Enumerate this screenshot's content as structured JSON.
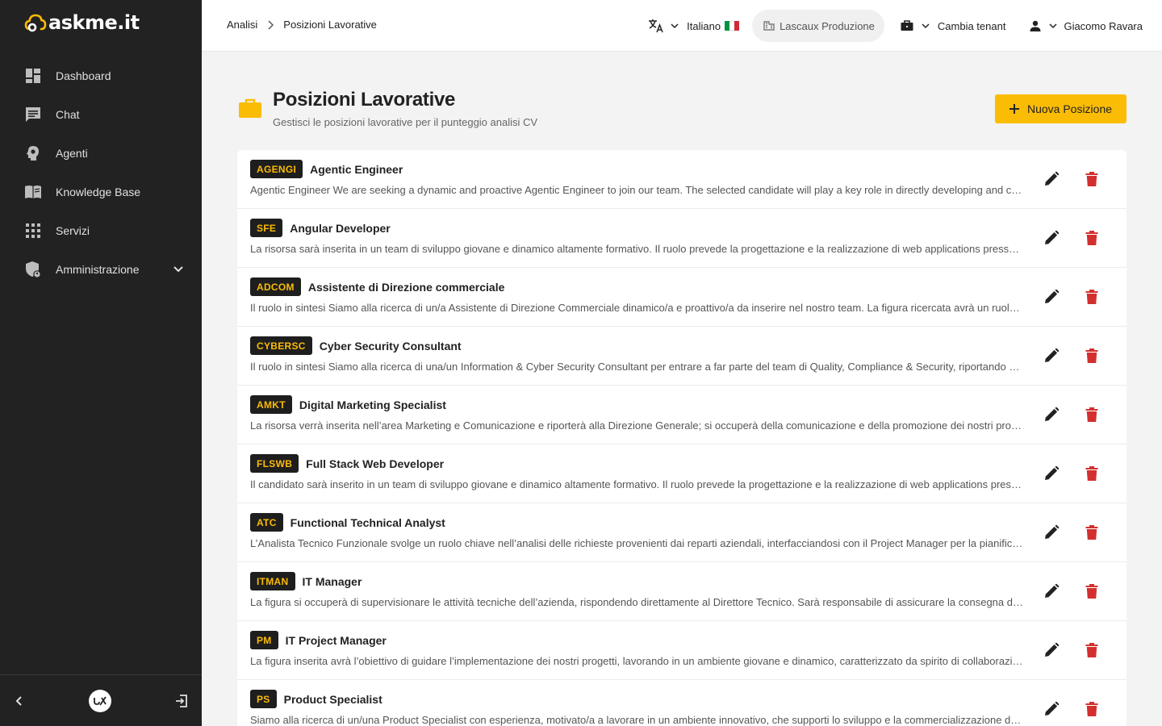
{
  "app": {
    "logo_text": "askme.it",
    "accent": "#fbbc05",
    "danger": "#d32f2f"
  },
  "sidebar": {
    "items": [
      {
        "label": "Dashboard",
        "icon": "dashboard-icon"
      },
      {
        "label": "Chat",
        "icon": "chat-icon"
      },
      {
        "label": "Agenti",
        "icon": "agent-icon"
      },
      {
        "label": "Knowledge Base",
        "icon": "book-icon"
      },
      {
        "label": "Servizi",
        "icon": "apps-grid-icon"
      },
      {
        "label": "Amministrazione",
        "icon": "admin-shield-icon"
      }
    ]
  },
  "topbar": {
    "breadcrumb": [
      "Analisi",
      "Posizioni Lavorative"
    ],
    "language": "Italiano",
    "tenant": "Lascaux Produzione",
    "switch_tenant": "Cambia tenant",
    "user": "Giacomo Ravara"
  },
  "page": {
    "title": "Posizioni Lavorative",
    "subtitle": "Gestisci le posizioni lavorative per il punteggio analisi CV",
    "new_button": "Nuova Posizione"
  },
  "positions": [
    {
      "code": "AGENGI",
      "name": "Agentic Engineer",
      "desc": "Agentic Engineer We are seeking a dynamic and proactive Agentic Engineer to join our team. The selected candidate will play a key role in directly developing and creating innovative solutions."
    },
    {
      "code": "SFE",
      "name": "Angular Developer",
      "desc": "La risorsa sarà inserita in un team di sviluppo giovane e dinamico altamente formativo. Il ruolo prevede la progettazione e la realizzazione di web applications presso i nostri clienti."
    },
    {
      "code": "ADCOM",
      "name": "Assistente di Direzione commerciale",
      "desc": "Il ruolo in sintesi Siamo alla ricerca di un/a Assistente di Direzione Commerciale dinamico/a e proattivo/a da inserire nel nostro team. La figura ricercata avrà un ruolo chiave."
    },
    {
      "code": "CYBERSC",
      "name": "Cyber Security Consultant",
      "desc": "Il ruolo in sintesi Siamo alla ricerca di una/un Information & Cyber Security Consultant per entrare a far parte del team di Quality, Compliance & Security, riportando direttamente."
    },
    {
      "code": "AMKT",
      "name": "Digital Marketing Specialist",
      "desc": "La risorsa verrà inserita nell’area Marketing e Comunicazione e riporterà alla Direzione Generale; si occuperà della comunicazione e della promozione dei nostri prodotti."
    },
    {
      "code": "FLSWB",
      "name": "Full Stack Web Developer",
      "desc": "Il candidato sarà inserito in un team di sviluppo giovane e dinamico altamente formativo. Il ruolo prevede la progettazione e la realizzazione di web applications presso i clienti."
    },
    {
      "code": "ATC",
      "name": "Functional Technical Analyst",
      "desc": "L’Analista Tecnico Funzionale svolge un ruolo chiave nell’analisi delle richieste provenienti dai reparti aziendali, interfacciandosi con il Project Manager per la pianificazione."
    },
    {
      "code": "ITMAN",
      "name": "IT Manager",
      "desc": "La figura si occuperà di supervisionare le attività tecniche dell’azienda, rispondendo direttamente al Direttore Tecnico. Sarà responsabile di assicurare la consegna dei progetti."
    },
    {
      "code": "PM",
      "name": "IT Project Manager",
      "desc": "La figura inserita avrà l’obiettivo di guidare l’implementazione dei nostri progetti, lavorando in un ambiente giovane e dinamico, caratterizzato da spirito di collaborazione."
    },
    {
      "code": "PS",
      "name": "Product Specialist",
      "desc": "Siamo alla ricerca di un/una Product Specialist con esperienza, motivato/a a lavorare in un ambiente innovativo, che supporti lo sviluppo e la commercializzazione dei prodotti."
    }
  ]
}
